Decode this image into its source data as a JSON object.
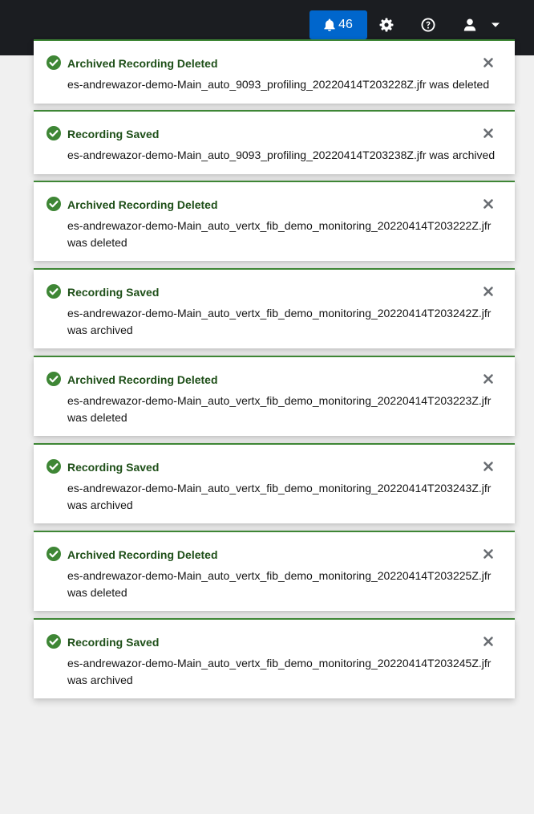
{
  "masthead": {
    "notification_count": "46",
    "icons": {
      "bell": "bell-icon",
      "settings": "gear-icon",
      "help": "question-circle-icon",
      "user": "user-icon",
      "caret": "caret-down-icon"
    }
  },
  "alerts": [
    {
      "title": "Archived Recording Deleted",
      "description": "es-andrewazor-demo-Main_auto_9093_profiling_20220414T203228Z.jfr was deleted"
    },
    {
      "title": "Recording Saved",
      "description": "es-andrewazor-demo-Main_auto_9093_profiling_20220414T203238Z.jfr was archived"
    },
    {
      "title": "Archived Recording Deleted",
      "description": "es-andrewazor-demo-Main_auto_vertx_fib_demo_monitoring_20220414T203222Z.jfr was deleted"
    },
    {
      "title": "Recording Saved",
      "description": "es-andrewazor-demo-Main_auto_vertx_fib_demo_monitoring_20220414T203242Z.jfr was archived"
    },
    {
      "title": "Archived Recording Deleted",
      "description": "es-andrewazor-demo-Main_auto_vertx_fib_demo_monitoring_20220414T203223Z.jfr was deleted"
    },
    {
      "title": "Recording Saved",
      "description": "es-andrewazor-demo-Main_auto_vertx_fib_demo_monitoring_20220414T203243Z.jfr was archived"
    },
    {
      "title": "Archived Recording Deleted",
      "description": "es-andrewazor-demo-Main_auto_vertx_fib_demo_monitoring_20220414T203225Z.jfr was deleted"
    },
    {
      "title": "Recording Saved",
      "description": "es-andrewazor-demo-Main_auto_vertx_fib_demo_monitoring_20220414T203245Z.jfr was archived"
    }
  ],
  "colors": {
    "masthead_bg": "#1b1d21",
    "badge_bg": "#0066cc",
    "success": "#3e8635",
    "title": "#1e4f18",
    "page_bg": "#f0f0f0"
  }
}
